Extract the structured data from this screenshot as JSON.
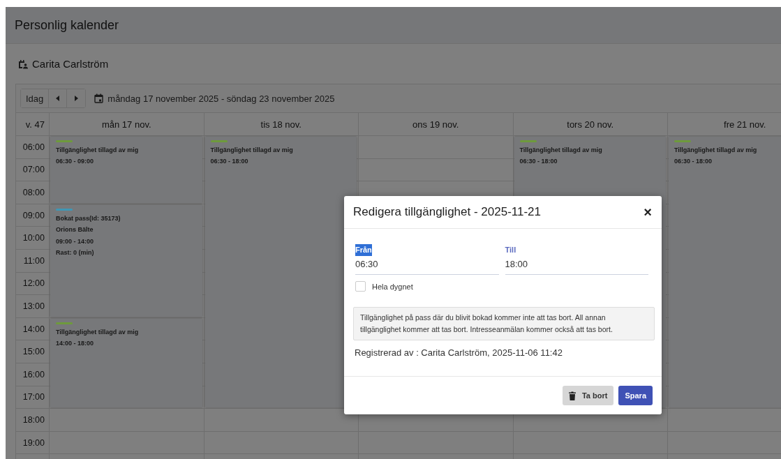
{
  "page_title": "Personlig kalender",
  "person": {
    "name": "Carita Carlström"
  },
  "toolbar": {
    "today_button": "Idag",
    "date_range": "måndag 17 november 2025 - söndag 23 november 2025"
  },
  "calendar": {
    "week_label": "v. 47",
    "hours": [
      "06:00",
      "07:00",
      "08:00",
      "09:00",
      "10:00",
      "11:00",
      "12:00",
      "13:00",
      "14:00",
      "15:00",
      "16:00",
      "17:00",
      "18:00",
      "19:00"
    ],
    "days": [
      {
        "label": "mån 17 nov.",
        "events": [
          {
            "kind": "availability",
            "color": "#6e9a3c",
            "title": "Tillgänglighet tillagd av mig",
            "time": "06:30 - 09:00"
          },
          {
            "kind": "booking",
            "color": "#3f97b5",
            "title": "Bokat pass(Id: 35173)",
            "place": "Orions Bälte",
            "time": "09:00 - 14:00",
            "note": "Rast: 0 (min)"
          },
          {
            "kind": "availability",
            "color": "#6e9a3c",
            "title": "Tillgänglighet tillagd av mig",
            "time": "14:00 - 18:00"
          }
        ]
      },
      {
        "label": "tis 18 nov.",
        "events": [
          {
            "kind": "availability",
            "color": "#6e9a3c",
            "title": "Tillgänglighet tillagd av mig",
            "time": "06:30 - 18:00"
          }
        ]
      },
      {
        "label": "ons 19 nov."
      },
      {
        "label": "tors 20 nov.",
        "events": [
          {
            "kind": "availability",
            "color": "#6e9a3c",
            "title": "Tillgänglighet tillagd av mig",
            "time": "06:30 - 18:00"
          }
        ]
      },
      {
        "label": "fre 21 nov.",
        "events": [
          {
            "kind": "availability",
            "color": "#6e9a3c",
            "title": "Tillgänglighet tillagd av mig",
            "time": "06:30 - 18:00"
          }
        ]
      }
    ]
  },
  "dialog": {
    "title": "Redigera tillgänglighet - 2025-11-21",
    "close": "×",
    "fields": [
      {
        "label": "Från",
        "value": "06:30",
        "highlighted": true
      },
      {
        "label": "Till",
        "value": "18:00",
        "highlighted": false
      }
    ],
    "all_day": {
      "label": "Hela dygnet",
      "checked": false
    },
    "info": "Tillgänglighet på pass där du blivit bokad kommer inte att tas bort. All annan tillgänglighet kommer att tas bort. Intresseanmälan kommer också att tas bort.",
    "registered": "Registrerad av : Carita Carlström, 2025-11-06 11:42",
    "buttons": [
      {
        "kind": "delete",
        "label": "Ta bort"
      },
      {
        "kind": "primary",
        "label": "Spara"
      }
    ]
  }
}
